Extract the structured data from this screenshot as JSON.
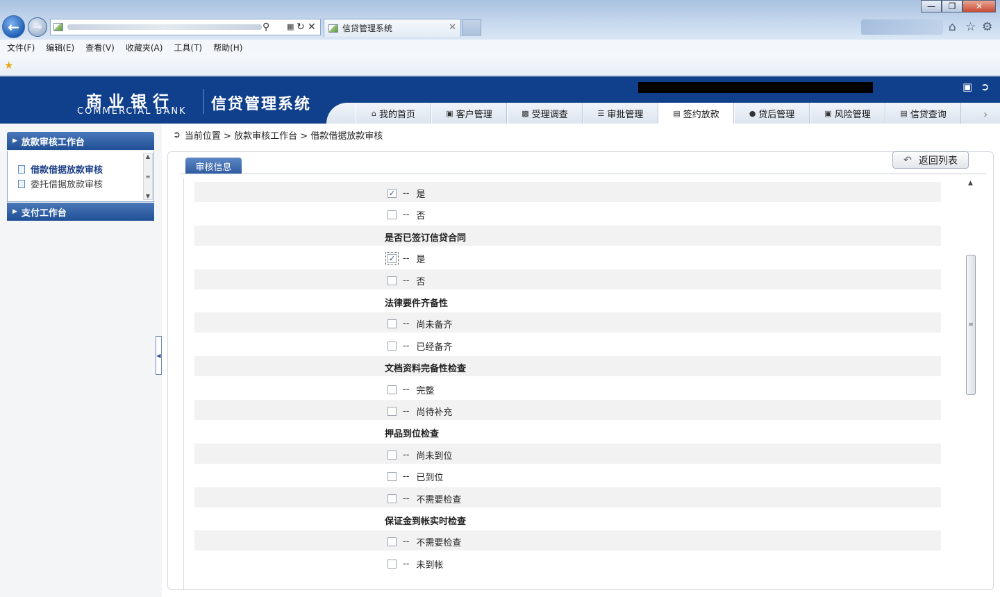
{
  "browser": {
    "tab_title": "信贷管理系统",
    "menu": [
      "文件(F)",
      "编辑(E)",
      "查看(V)",
      "收藏夹(A)",
      "工具(T)",
      "帮助(H)"
    ]
  },
  "header": {
    "logo_cn": "商业银行",
    "logo_en": "COMMERCIAL BANK",
    "system_title": "信贷管理系统",
    "nav": [
      {
        "label": "我的首页",
        "icon": "home-icon"
      },
      {
        "label": "客户管理",
        "icon": "client-icon"
      },
      {
        "label": "受理调查",
        "icon": "survey-icon"
      },
      {
        "label": "审批管理",
        "icon": "approval-icon"
      },
      {
        "label": "签约放款",
        "icon": "contract-icon",
        "active": true
      },
      {
        "label": "贷后管理",
        "icon": "postloan-icon"
      },
      {
        "label": "风险管理",
        "icon": "risk-icon"
      },
      {
        "label": "信贷查询",
        "icon": "query-icon"
      }
    ]
  },
  "sidebar": {
    "section1": "放款审核工作台",
    "items": [
      "借款借据放款审核",
      "委托借据放款审核"
    ],
    "section2": "支付工作台"
  },
  "breadcrumb": {
    "text": "当前位置 > 放款审核工作台 > 借款借据放款审核"
  },
  "panel": {
    "tab_label": "审核信息",
    "return_label": "返回列表"
  },
  "form": {
    "dash": "--",
    "rows": [
      {
        "type": "option",
        "label": "是",
        "checked": true
      },
      {
        "type": "option",
        "label": "否",
        "checked": false
      },
      {
        "type": "heading",
        "label": "是否已签订信贷合同"
      },
      {
        "type": "option",
        "label": "是",
        "checked": true,
        "focused": true
      },
      {
        "type": "option",
        "label": "否",
        "checked": false
      },
      {
        "type": "heading",
        "label": "法律要件齐备性"
      },
      {
        "type": "option",
        "label": "尚未备齐",
        "checked": false
      },
      {
        "type": "option",
        "label": "已经备齐",
        "checked": false
      },
      {
        "type": "heading",
        "label": "文档资料完备性检查"
      },
      {
        "type": "option",
        "label": "完整",
        "checked": false
      },
      {
        "type": "option",
        "label": "尚待补充",
        "checked": false
      },
      {
        "type": "heading",
        "label": "押品到位检查"
      },
      {
        "type": "option",
        "label": "尚未到位",
        "checked": false
      },
      {
        "type": "option",
        "label": "已到位",
        "checked": false
      },
      {
        "type": "option",
        "label": "不需要检查",
        "checked": false
      },
      {
        "type": "heading",
        "label": "保证金到帐实时检查"
      },
      {
        "type": "option",
        "label": "不需要检查",
        "checked": false
      },
      {
        "type": "option",
        "label": "未到帐",
        "checked": false
      }
    ]
  },
  "colors": {
    "brand": "#10408c",
    "sidebar_head": "#2d5aa0"
  }
}
